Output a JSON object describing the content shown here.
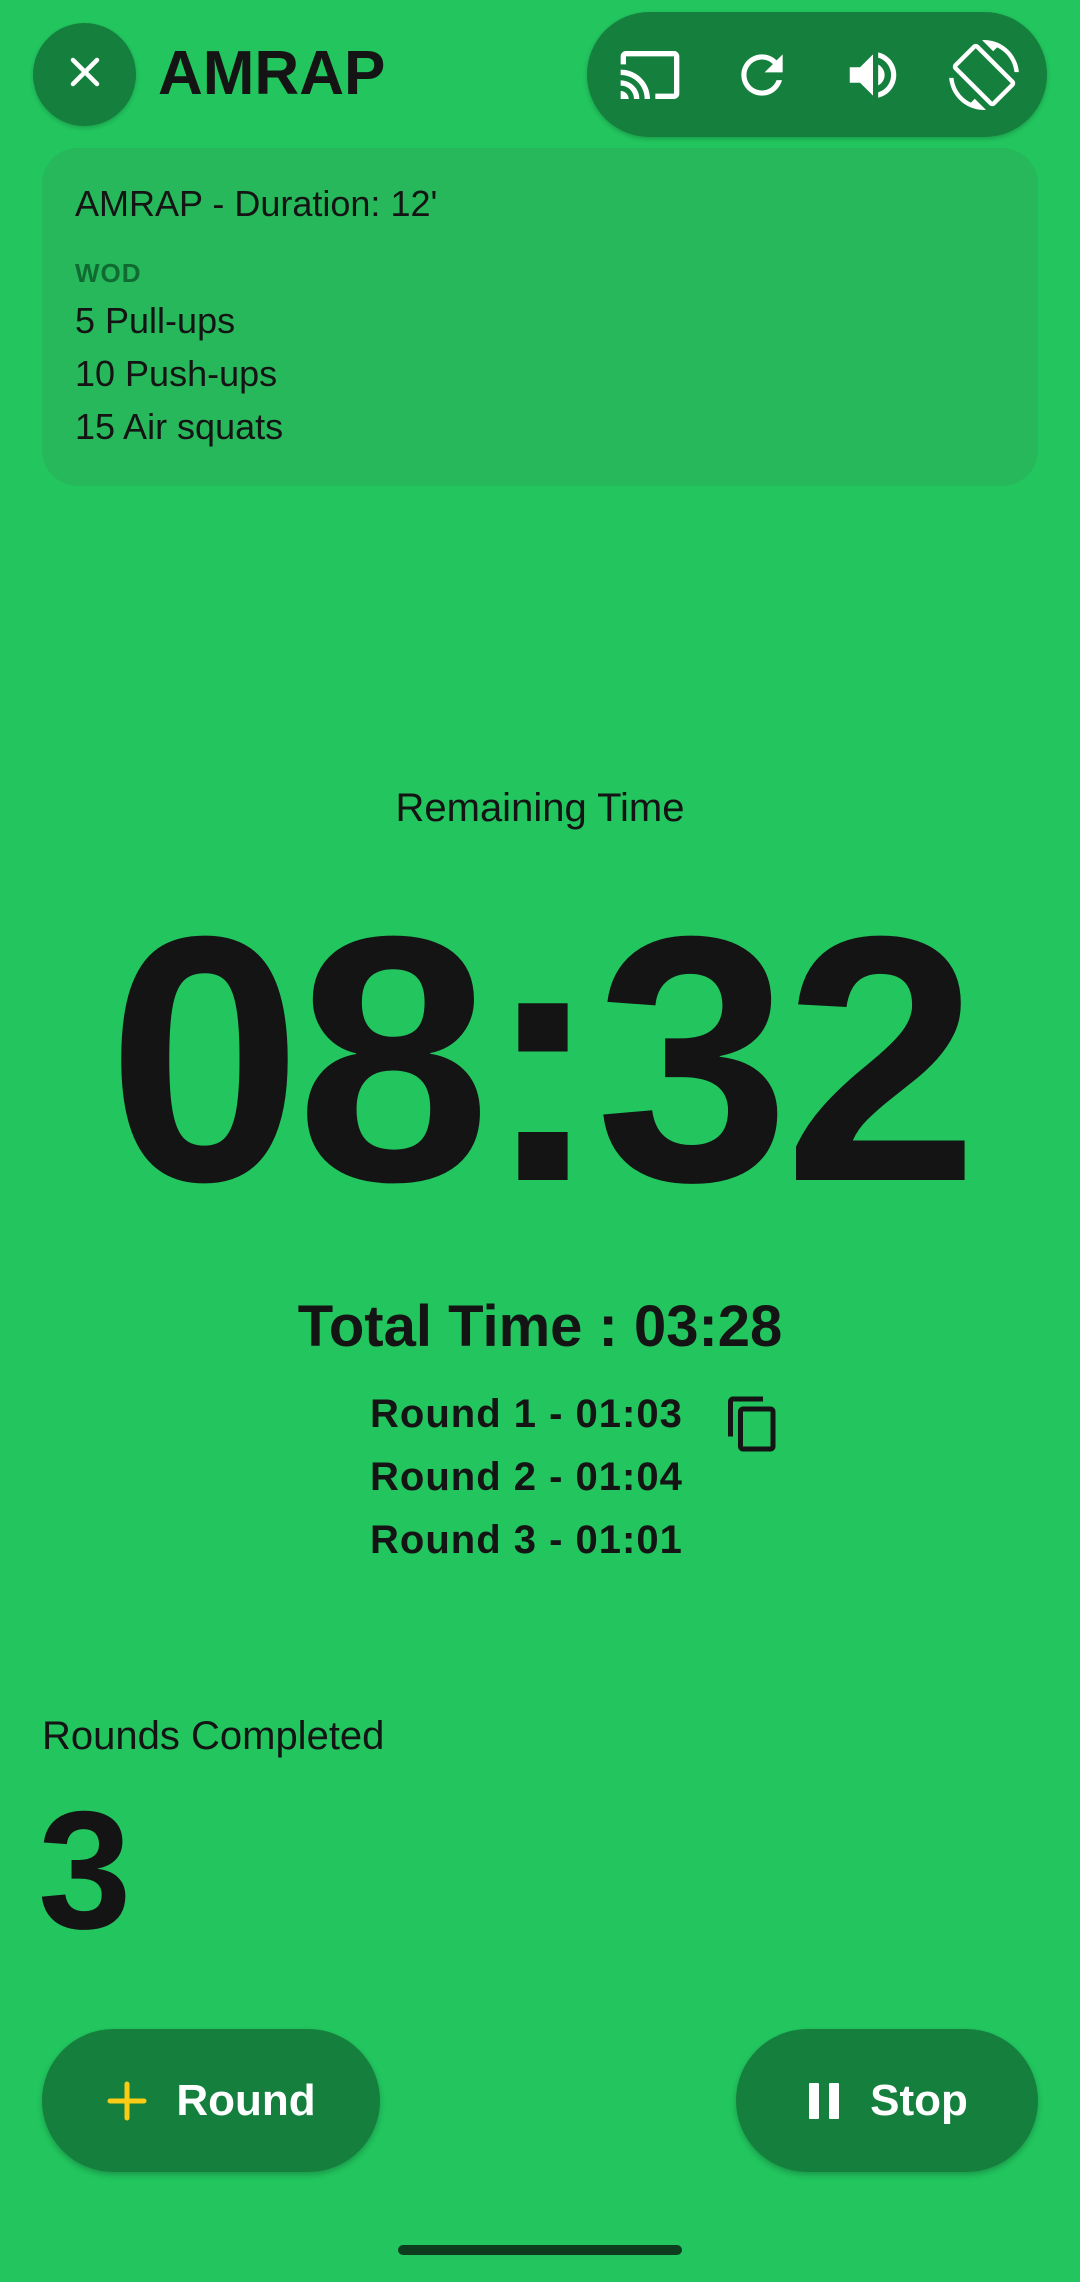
{
  "header": {
    "title": "AMRAP",
    "close_icon": "close-icon",
    "toolbar_icons": [
      "cast-icon",
      "refresh-icon",
      "volume-icon",
      "screen-rotation-icon"
    ]
  },
  "wod_card": {
    "title": "AMRAP - Duration: 12'",
    "label": "WOD",
    "exercises": [
      "5 Pull-ups",
      "10 Push-ups",
      "15 Air squats"
    ]
  },
  "timer": {
    "label": "Remaining Time",
    "value": "08:32"
  },
  "total_time": "Total Time : 03:28",
  "rounds": [
    "Round 1 - 01:03",
    "Round 2 - 01:04",
    "Round 3 - 01:01"
  ],
  "copy_icon": "copy-icon",
  "rounds_completed": {
    "label": "Rounds Completed",
    "value": "3"
  },
  "buttons": {
    "round_label": "Round",
    "round_icon": "plus-icon",
    "stop_label": "Stop",
    "stop_icon": "pause-icon"
  },
  "colors": {
    "background": "#22c55e",
    "button": "#15803d",
    "accent_plus": "#facc15",
    "text": "#141414"
  }
}
